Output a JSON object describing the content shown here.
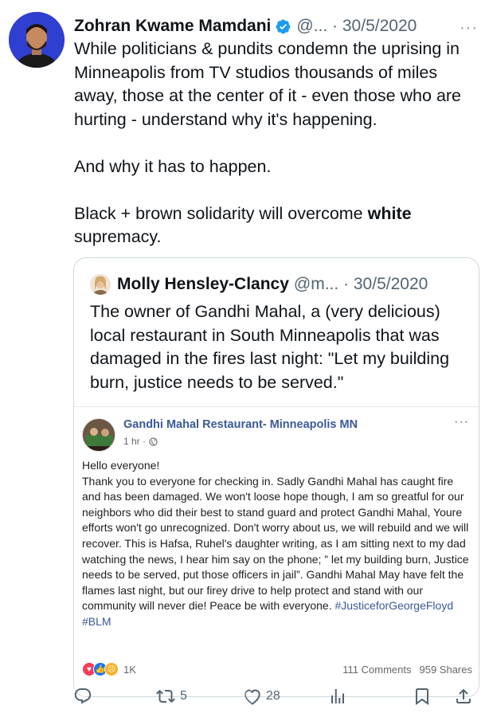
{
  "tweet": {
    "author_name": "Zohran Kwame Mamdani",
    "handle_date": "@... · 30/5/2020",
    "more": "···",
    "paragraphs": [
      "While politicians & pundits condemn the uprising in Minneapolis from TV studios thousands of miles away, those at the center of it - even those who are hurting - understand why it's happening.",
      "And why it has to happen."
    ],
    "last_paragraph_pre": "Black + brown solidarity will overcome ",
    "last_paragraph_bold": "white",
    "last_paragraph_post": " supremacy."
  },
  "quote": {
    "author_name": "Molly Hensley-Clancy",
    "handle_date": "@m... · 30/5/2020",
    "text": "The owner of Gandhi Mahal, a (very delicious) local restaurant in South Minneapolis that was damaged in the fires last night: \"Let my building burn, justice needs to be served.\""
  },
  "fb_post": {
    "page_name": "Gandhi Mahal Restaurant- Minneapolis MN",
    "time": "1 hr ·",
    "more": "···",
    "body": "Hello everyone!\nThank you to everyone for checking in. Sadly Gandhi Mahal has caught fire and has been damaged. We won't loose hope though, I am so greatful for our ⁣neighbors who did their best to stand guard and protect Gandhi Mahal, Youre efforts won't go unrecognized. Don't worry about us, we will rebuild and we will recover. This is Hafsa, Ruhel's daughter writing, as I am sitting next to my dad watching the news, I hear him say on the phone; ” let my building burn, Justice needs to be served, put those officers in jail”. Gandhi Mahal May have felt the flames last night, but our firey drive to help protect and stand with our community will never die! Peace be with everyone.",
    "hashtags": " #JusticeforGeorgeFloyd #BLM",
    "reaction_count": "1K",
    "comments": "111 Comments",
    "shares": "959 Shares"
  },
  "actions": {
    "retweets": "5",
    "likes": "28"
  },
  "colors": {
    "verified": "#1d9bf0",
    "secondary_text": "#536471",
    "facebook_link": "#3b5998"
  }
}
